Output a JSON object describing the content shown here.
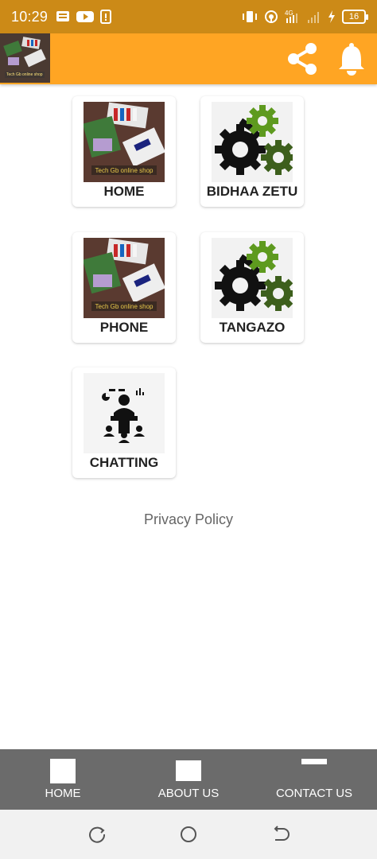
{
  "status_bar": {
    "time": "10:29",
    "left_icons": [
      "message-icon",
      "youtube-icon",
      "phone-update-icon"
    ],
    "right_icons": [
      "vibrate-icon",
      "hotspot-icon",
      "4g-signal-icon",
      "signal-icon",
      "charging-icon"
    ],
    "battery": "16",
    "network": "4G"
  },
  "toolbar": {
    "logo_text": "Tech Gb online shop",
    "share_icon": "share-icon",
    "bell_icon": "bell-icon",
    "bg_color": "#ffa523"
  },
  "tiles": [
    {
      "label": "HOME",
      "image": "shop-photo"
    },
    {
      "label": "BIDHAA ZETU",
      "image": "gears-icon"
    },
    {
      "label": "PHONE",
      "image": "shop-photo"
    },
    {
      "label": "TANGAZO",
      "image": "gears-icon"
    },
    {
      "label": "CHATTING",
      "image": "meeting-icon"
    }
  ],
  "shop_photo_caption": "Tech Gb online shop",
  "privacy_policy": "Privacy Policy",
  "bottom_nav": {
    "items": [
      {
        "label": "HOME"
      },
      {
        "label": "ABOUT US"
      },
      {
        "label": "CONTACT US"
      }
    ],
    "bg_color": "#6b6b6b"
  },
  "system_nav": [
    "recents-icon",
    "home-circle-icon",
    "back-icon"
  ]
}
